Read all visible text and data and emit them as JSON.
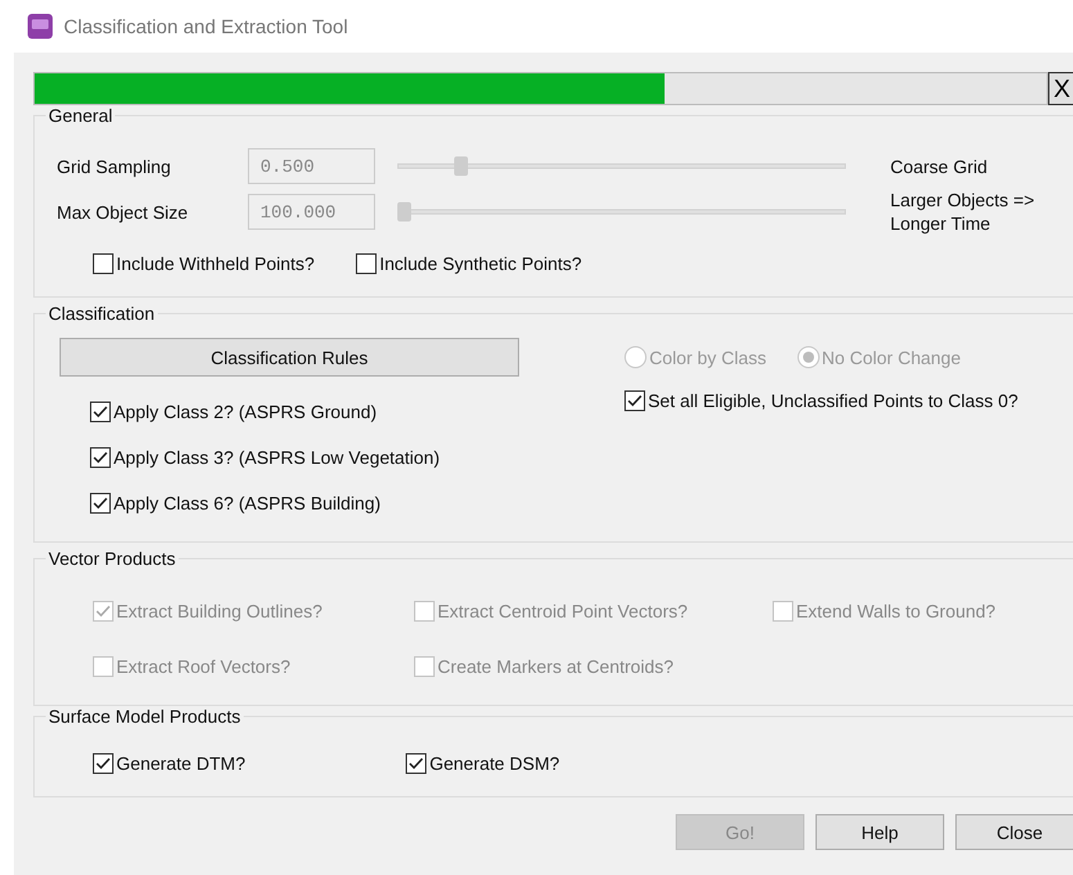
{
  "window": {
    "title": "Classification and Extraction Tool"
  },
  "progress": {
    "level": 0.622,
    "cancel": "X"
  },
  "general": {
    "title": "General",
    "sliders": [
      {
        "label": "Grid Sampling",
        "value": "0.500",
        "level": 0.13,
        "note": "Coarse Grid"
      },
      {
        "label": "Max Object Size",
        "value": "100.000",
        "level": 0.0,
        "note": "Larger Objects => Longer Time"
      }
    ],
    "checkboxes": [
      {
        "label": "Include Withheld Points?",
        "checked": false
      },
      {
        "label": "Include Synthetic Points?",
        "checked": false
      }
    ]
  },
  "classification": {
    "title": "Classification",
    "rules_button": "Classification Rules",
    "radios": [
      {
        "label": "Color by Class",
        "selected": false,
        "disabled": true
      },
      {
        "label": "No Color Change",
        "selected": true,
        "disabled": true
      }
    ],
    "checkboxes": [
      {
        "label": "Apply Class 2? (ASPRS Ground)",
        "checked": true
      },
      {
        "label": "Apply Class 3? (ASPRS Low Vegetation)",
        "checked": true
      },
      {
        "label": "Apply Class 6? (ASPRS Building)",
        "checked": true
      }
    ],
    "side_checkbox": {
      "label": "Set all Eligible, Unclassified Points to Class 0?",
      "checked": true
    }
  },
  "vector_products": {
    "title": "Vector Products",
    "checkboxes": [
      {
        "label": "Extract Building Outlines?",
        "checked": true,
        "disabled": true
      },
      {
        "label": "Extract Centroid Point Vectors?",
        "checked": false,
        "disabled": true
      },
      {
        "label": "Extend Walls to Ground?",
        "checked": false,
        "disabled": true
      },
      {
        "label": "Extract Roof Vectors?",
        "checked": false,
        "disabled": true
      },
      {
        "label": "Create Markers at Centroids?",
        "checked": false,
        "disabled": true
      }
    ]
  },
  "surface": {
    "title": "Surface Model Products",
    "checkboxes": [
      {
        "label": "Generate DTM?",
        "checked": true
      },
      {
        "label": "Generate DSM?",
        "checked": true
      }
    ]
  },
  "buttons": [
    {
      "label": "Go!",
      "disabled": true
    },
    {
      "label": "Help",
      "disabled": false
    },
    {
      "label": "Close",
      "disabled": false
    }
  ]
}
